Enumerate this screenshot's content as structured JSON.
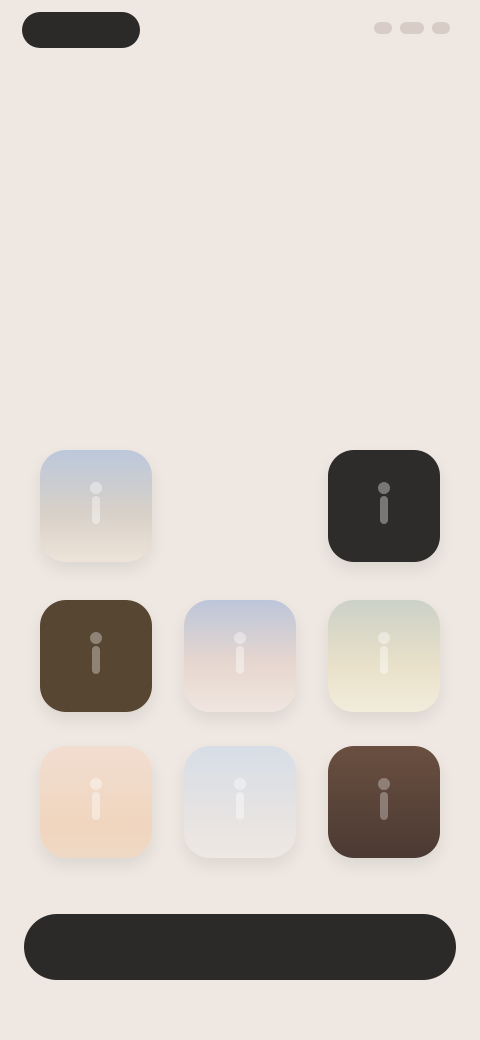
{
  "header": {
    "left_pill_label": "",
    "right_indicator_label": ""
  },
  "main": {
    "title": ""
  },
  "grid": {
    "plus_icon": "plus-icon",
    "tiles": [
      {
        "name": "tile-1",
        "color": "#bcc8dc",
        "icon": "figure-icon"
      },
      {
        "name": "tile-2",
        "color": "#2d2c2b",
        "icon": "figure-icon"
      },
      {
        "name": "tile-3",
        "color": "#574632",
        "icon": "figure-icon"
      },
      {
        "name": "tile-4",
        "color": "#bcc6da",
        "icon": "figure-icon"
      },
      {
        "name": "tile-5",
        "color": "#ccd1c8",
        "icon": "figure-icon"
      },
      {
        "name": "tile-6",
        "color": "#f1ddd0",
        "icon": "figure-icon"
      },
      {
        "name": "tile-7",
        "color": "#d7dde6",
        "icon": "figure-icon"
      },
      {
        "name": "tile-8",
        "color": "#6a4f40",
        "icon": "figure-icon"
      }
    ]
  },
  "footer": {
    "primary_button_label": ""
  }
}
